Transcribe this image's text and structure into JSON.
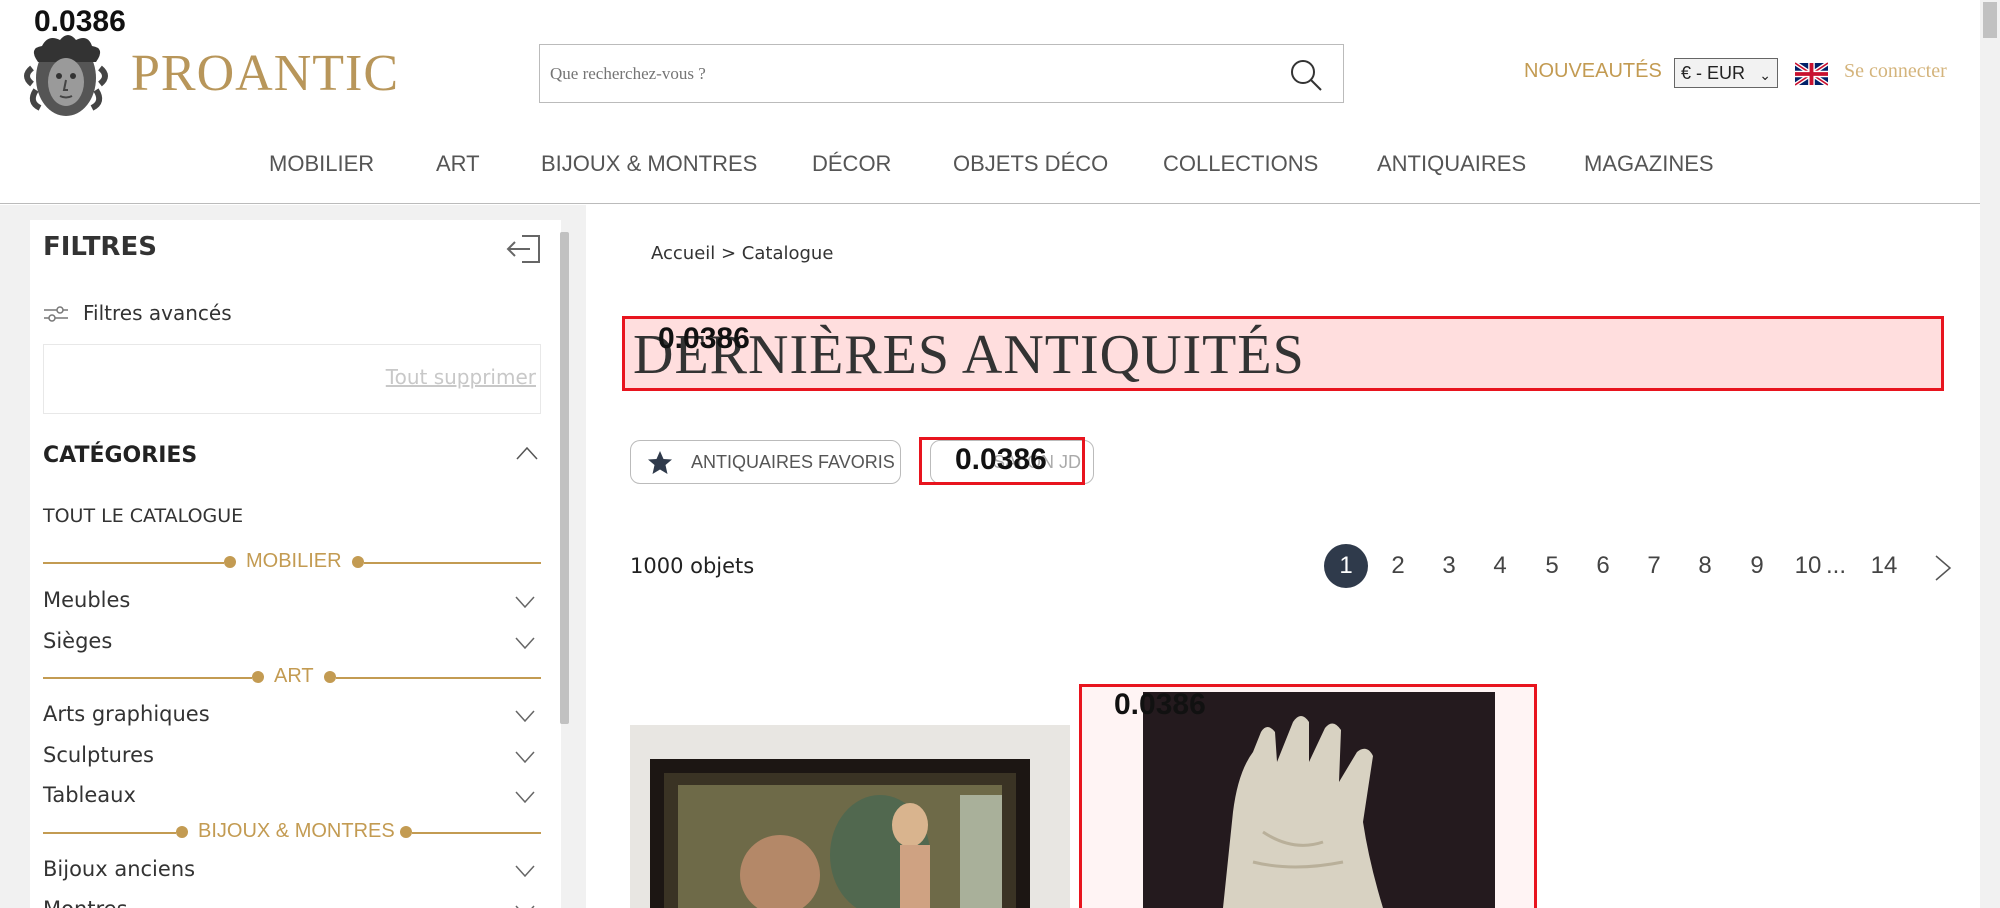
{
  "overlays": {
    "score_label": "0.0386"
  },
  "header": {
    "brand": "PROANTIC",
    "search_placeholder": "Que recherchez-vous ?",
    "nouveautes": "NOUVEAUTÉS",
    "currency": "€ - EUR",
    "login": "Se connecter",
    "nav": [
      "MOBILIER",
      "ART",
      "BIJOUX & MONTRES",
      "DÉCOR",
      "OBJETS DÉCO",
      "COLLECTIONS",
      "ANTIQUAIRES",
      "MAGAZINES"
    ]
  },
  "sidebar": {
    "title": "FILTRES",
    "advanced": "Filtres avancés",
    "clear_all": "Tout supprimer",
    "categories_title": "CATÉGORIES",
    "all_catalogue": "TOUT LE CATALOGUE",
    "groups": {
      "mobilier": "MOBILIER",
      "art": "ART",
      "bijoux": "BIJOUX & MONTRES"
    },
    "items": {
      "meubles": "Meubles",
      "sieges": "Sièges",
      "arts_graphiques": "Arts graphiques",
      "sculptures": "Sculptures",
      "tableaux": "Tableaux",
      "bijoux_anciens": "Bijoux anciens",
      "montres": "Montres"
    }
  },
  "main": {
    "breadcrumb": "Accueil > Catalogue",
    "title": "DERNIÈRES ANTIQUITÉS",
    "fav_button": "ANTIQUAIRES FAVORIS",
    "second_button": "SALON JD",
    "count": "1000 objets",
    "pages": [
      "1",
      "2",
      "3",
      "4",
      "5",
      "6",
      "7",
      "8",
      "9",
      "10",
      "...",
      "14"
    ],
    "current_page": "1"
  },
  "colors": {
    "accent": "#c39b52",
    "highlight": "#e8141e",
    "active_page": "#2f3a4b"
  }
}
